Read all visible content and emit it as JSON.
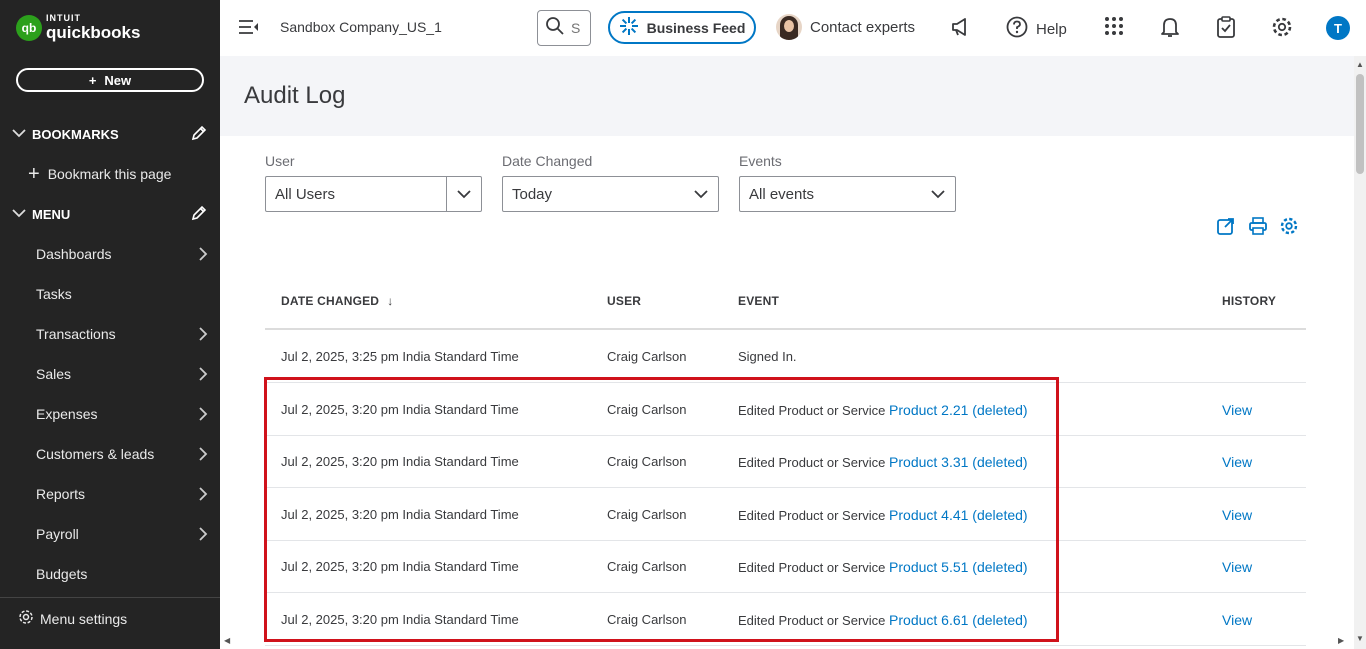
{
  "sidebar": {
    "logo": {
      "intuit": "INTUIT",
      "product": "quickbooks",
      "badge": "qb"
    },
    "new_label": "New",
    "bookmarks_heading": "BOOKMARKS",
    "bookmark_this_page": "Bookmark this page",
    "menu_heading": "MENU",
    "items": [
      {
        "label": "Dashboards",
        "has_arrow": true
      },
      {
        "label": "Tasks",
        "has_arrow": false
      },
      {
        "label": "Transactions",
        "has_arrow": true
      },
      {
        "label": "Sales",
        "has_arrow": true
      },
      {
        "label": "Expenses",
        "has_arrow": true
      },
      {
        "label": "Customers & leads",
        "has_arrow": true
      },
      {
        "label": "Reports",
        "has_arrow": true
      },
      {
        "label": "Payroll",
        "has_arrow": true
      },
      {
        "label": "Budgets",
        "has_arrow": false
      }
    ],
    "menu_settings": "Menu settings"
  },
  "topbar": {
    "company": "Sandbox Company_US_1",
    "search_placeholder": "S",
    "business_feed": "Business Feed",
    "contact_experts": "Contact experts",
    "help": "Help",
    "user_initial": "T"
  },
  "page": {
    "title": "Audit Log"
  },
  "filters": {
    "user": {
      "label": "User",
      "value": "All Users"
    },
    "date_changed": {
      "label": "Date Changed",
      "value": "Today"
    },
    "events": {
      "label": "Events",
      "value": "All events"
    }
  },
  "table": {
    "headers": {
      "date": "DATE CHANGED",
      "sort": "↓",
      "user": "USER",
      "event": "EVENT",
      "history": "HISTORY"
    },
    "rows": [
      {
        "date": "Jul 2, 2025, 3:25 pm India Standard Time",
        "user": "Craig Carlson",
        "event": "Signed In.",
        "link": "",
        "history": ""
      },
      {
        "date": "Jul 2, 2025, 3:20 pm India Standard Time",
        "user": "Craig Carlson",
        "event": "Edited Product or Service ",
        "link": "Product 2.21 (deleted)",
        "history": "View"
      },
      {
        "date": "Jul 2, 2025, 3:20 pm India Standard Time",
        "user": "Craig Carlson",
        "event": "Edited Product or Service ",
        "link": "Product 3.31 (deleted)",
        "history": "View"
      },
      {
        "date": "Jul 2, 2025, 3:20 pm India Standard Time",
        "user": "Craig Carlson",
        "event": "Edited Product or Service ",
        "link": "Product 4.41 (deleted)",
        "history": "View"
      },
      {
        "date": "Jul 2, 2025, 3:20 pm India Standard Time",
        "user": "Craig Carlson",
        "event": "Edited Product or Service ",
        "link": "Product 5.51 (deleted)",
        "history": "View"
      },
      {
        "date": "Jul 2, 2025, 3:20 pm India Standard Time",
        "user": "Craig Carlson",
        "event": "Edited Product or Service ",
        "link": "Product 6.61 (deleted)",
        "history": "View"
      }
    ]
  },
  "colors": {
    "accent": "#0077c5",
    "brand_green": "#2ca01c",
    "sidebar_bg": "#242424",
    "highlight": "#d0121b"
  }
}
